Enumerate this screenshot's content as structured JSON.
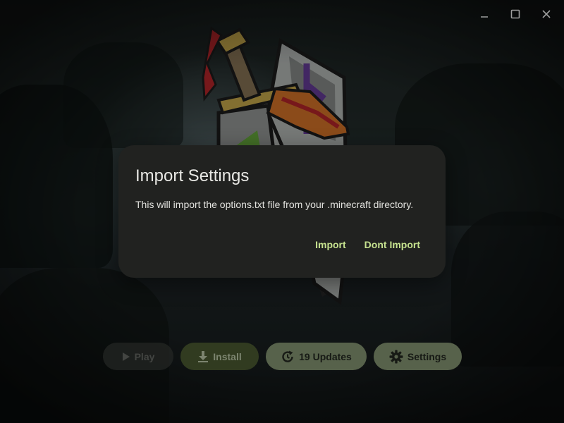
{
  "window_controls": {
    "minimize_icon": "minimize-icon",
    "maximize_icon": "maximize-icon",
    "close_icon": "close-icon"
  },
  "dialog": {
    "title": "Import Settings",
    "body": "This will import the options.txt file from your .minecraft directory.",
    "import_label": "Import",
    "dont_import_label": "Dont Import"
  },
  "bottom_bar": {
    "play_label": "Play",
    "install_label": "Install",
    "updates_label": "19 Updates",
    "settings_label": "Settings"
  },
  "colors": {
    "accent_text": "#c6e28f",
    "install_bg": "#4f6034",
    "secondary_bg": "#8d9e7a",
    "dialog_bg": "#212220"
  }
}
